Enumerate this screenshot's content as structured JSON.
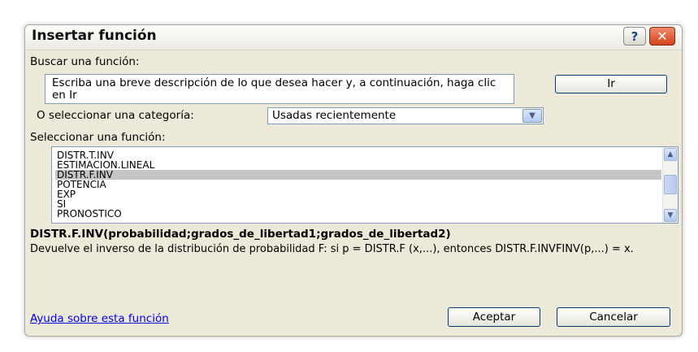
{
  "dialog": {
    "title": "Insertar función",
    "help_button": "?",
    "close_button": "✕"
  },
  "search": {
    "label": "Buscar una función:",
    "value": "Escriba una breve descripción de lo que desea hacer y, a continuación, haga clic en Ir",
    "go_button": "Ir"
  },
  "category": {
    "label": "O seleccionar una categoría:",
    "selected": "Usadas recientemente"
  },
  "function_list": {
    "label": "Seleccionar una función:",
    "items": [
      "DISTR.T.INV",
      "ESTIMACION.LINEAL",
      "DISTR.F.INV",
      "POTENCIA",
      "EXP",
      "SI",
      "PRONOSTICO"
    ],
    "selected_index": 2
  },
  "details": {
    "signature": "DISTR.F.INV(probabilidad;grados_de_libertad1;grados_de_libertad2)",
    "description": "Devuelve el inverso de la distribución de probabilidad F: si p = DISTR.F (x,...), entonces DISTR.F.INVFINV(p,...) = x."
  },
  "footer": {
    "help_link": "Ayuda sobre esta función",
    "ok_button": "Aceptar",
    "cancel_button": "Cancelar"
  },
  "icons": {
    "dropdown": "chevron-down-icon",
    "scroll_up": "chevron-up-icon",
    "scroll_down": "chevron-down-icon"
  }
}
